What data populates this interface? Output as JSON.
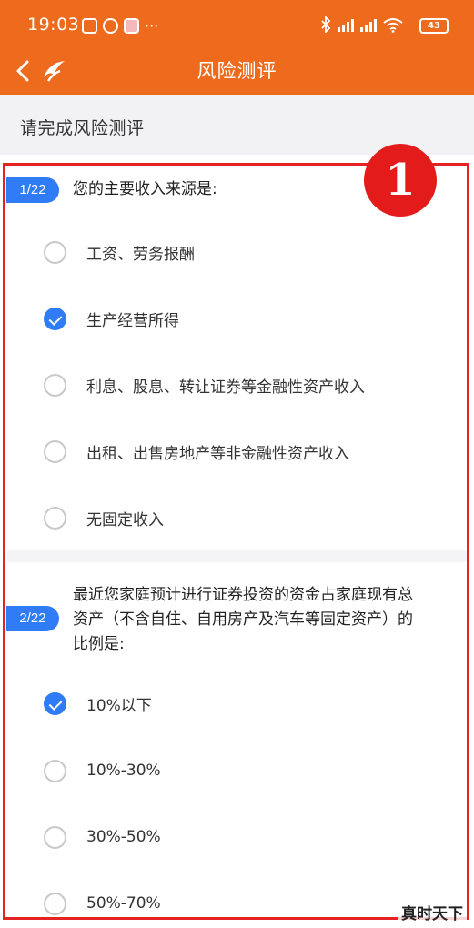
{
  "status_bar": {
    "time": "19:03",
    "battery": "43",
    "icons": [
      "hd-signal-icon",
      "hd-signal-icon",
      "wifi-icon",
      "bluetooth-icon"
    ]
  },
  "nav": {
    "title": "风险测评",
    "back_icon": "chevron-left-icon",
    "logo_icon": "app-logo-icon"
  },
  "section": {
    "title": "请完成风险测评"
  },
  "annotation": {
    "label": "1",
    "color": "#e42424"
  },
  "questions": [
    {
      "number": "1/22",
      "text": "您的主要收入来源是:",
      "options": [
        {
          "label": "工资、劳务报酬",
          "checked": false
        },
        {
          "label": "生产经营所得",
          "checked": true
        },
        {
          "label": "利息、股息、转让证券等金融性资产收入",
          "checked": false
        },
        {
          "label": "出租、出售房地产等非金融性资产收入",
          "checked": false
        },
        {
          "label": "无固定收入",
          "checked": false
        }
      ]
    },
    {
      "number": "2/22",
      "text": "最近您家庭预计进行证券投资的资金占家庭现有总资产（不含自住、自用房产及汽车等固定资产）的比例是:",
      "options": [
        {
          "label": "10%以下",
          "checked": false
        },
        {
          "label": "10%-30%",
          "checked": false
        },
        {
          "label": "30%-50%",
          "checked": false
        },
        {
          "label": "50%-70%",
          "checked": false
        }
      ]
    }
  ],
  "watermark": "真时天下",
  "colors": {
    "brand_orange": "#ee6a1c",
    "accent_blue": "#2f7cf6",
    "annotation_red": "#e42424"
  }
}
